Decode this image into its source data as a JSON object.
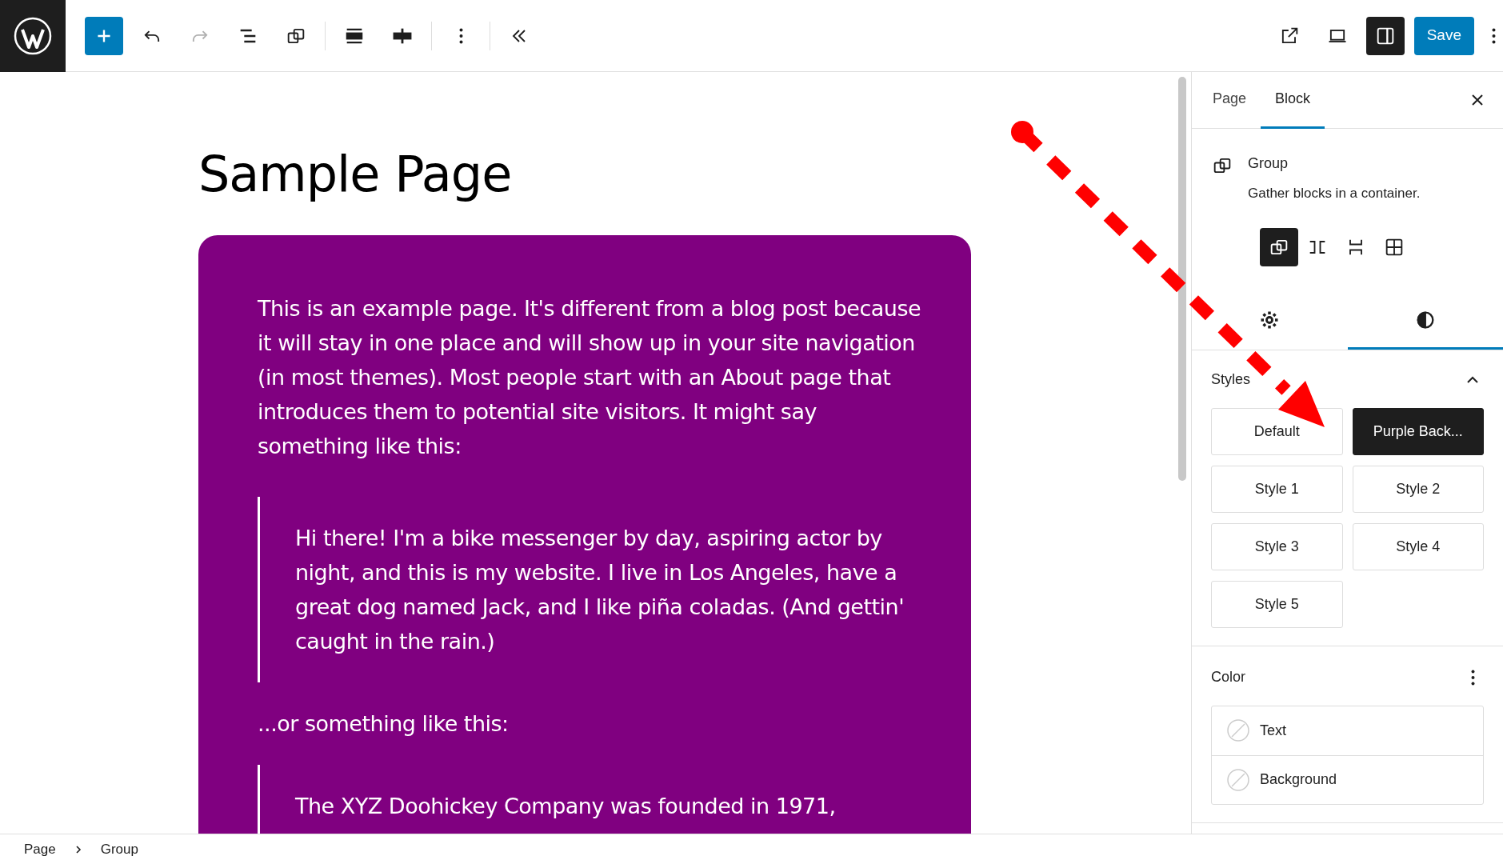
{
  "toolbar": {
    "redo": {
      "disabled": true
    },
    "settings_toggle": {
      "pressed": true
    },
    "save_label": "Save"
  },
  "canvas": {
    "title": "Sample Page",
    "intro": "This is an example page. It's different from a blog post because it will stay in one place and will show up in your site navigation (in most themes). Most people start with an About page that introduces them to potential site visitors. It might say something like this:",
    "quote_1": "Hi there! I'm a bike messenger by day, aspiring actor by night, and this is my website. I live in Los Angeles, have a great dog named Jack, and I like piña coladas. (And gettin' caught in the rain.)",
    "middle": "...or something like this:",
    "quote_2": "The XYZ Doohickey Company was founded in 1971,"
  },
  "sidebar": {
    "tabs": [
      {
        "label": "Page",
        "selected": false
      },
      {
        "label": "Block",
        "selected": true
      }
    ],
    "block": {
      "name": "Group",
      "description": "Gather blocks in a container."
    },
    "variations": [
      {
        "kind": "group",
        "selected": true
      },
      {
        "kind": "row",
        "selected": false
      },
      {
        "kind": "stack",
        "selected": false
      },
      {
        "kind": "grid",
        "selected": false
      }
    ],
    "inspector_tabs": [
      {
        "kind": "settings",
        "selected": false
      },
      {
        "kind": "styles",
        "selected": true
      }
    ],
    "styles": {
      "title": "Styles",
      "expanded": true,
      "options": [
        {
          "label": "Default",
          "selected": false
        },
        {
          "label": "Purple Back...",
          "selected": true
        },
        {
          "label": "Style 1",
          "selected": false
        },
        {
          "label": "Style 2",
          "selected": false
        },
        {
          "label": "Style 3",
          "selected": false
        },
        {
          "label": "Style 4",
          "selected": false
        },
        {
          "label": "Style 5",
          "selected": false
        }
      ]
    },
    "color": {
      "title": "Color",
      "items": [
        {
          "label": "Text"
        },
        {
          "label": "Background"
        }
      ]
    }
  },
  "breadcrumb": [
    "Page",
    "Group"
  ]
}
